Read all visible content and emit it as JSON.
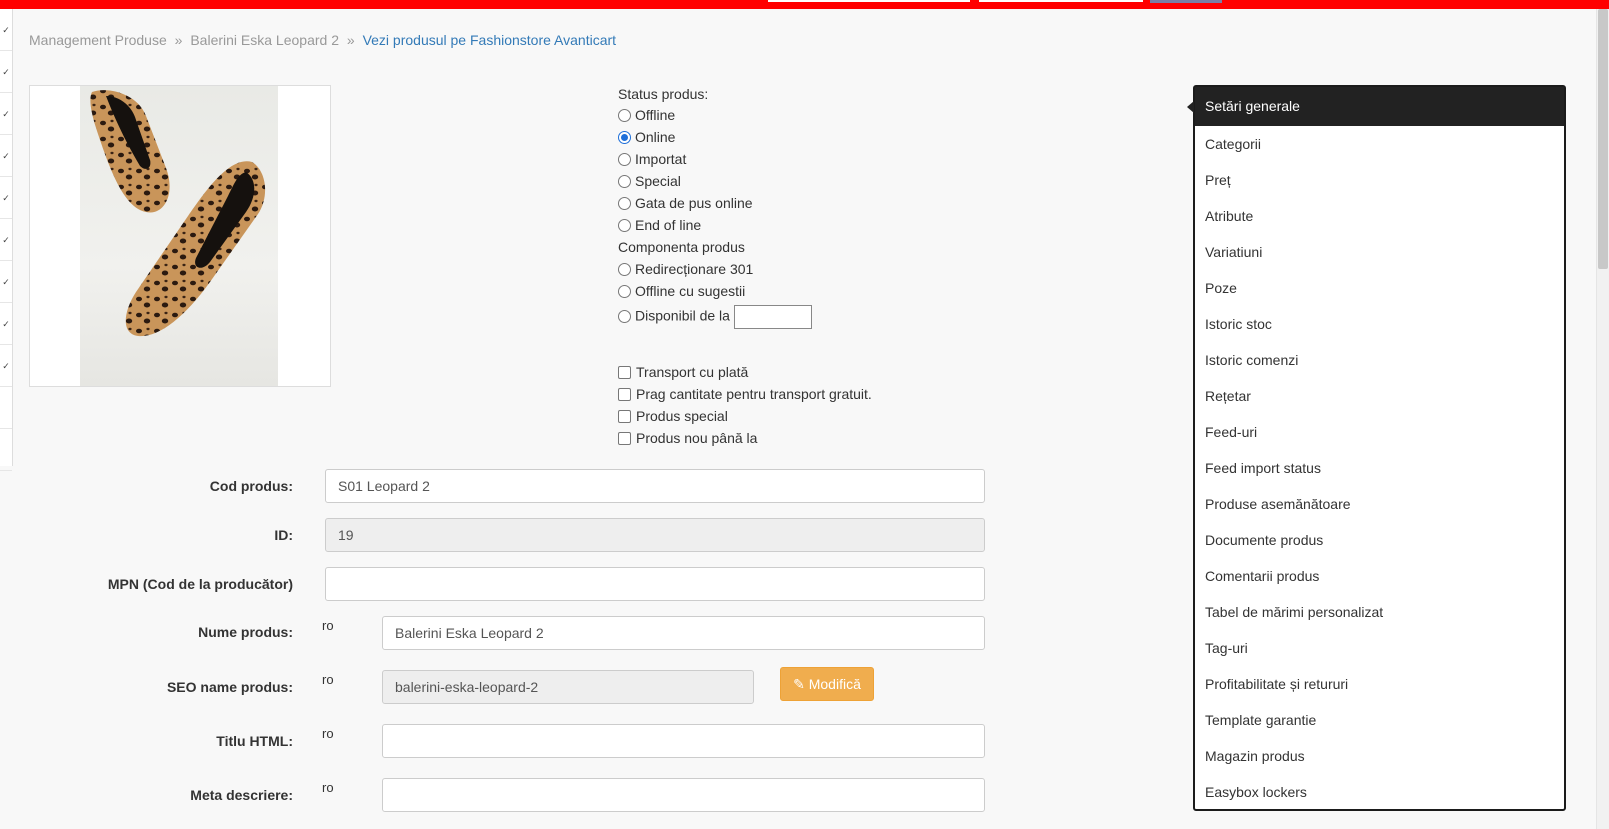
{
  "breadcrumb": {
    "item1": "Management Produse",
    "separator": "»",
    "item2": "Balerini Eska Leopard 2",
    "link": "Vezi produsul pe Fashionstore Avanticart"
  },
  "status": {
    "title": "Status produs:",
    "options": [
      "Offline",
      "Online",
      "Importat",
      "Special",
      "Gata de pus online",
      "End of line"
    ],
    "selected": "Online",
    "component_title": "Componenta produs",
    "component_options": [
      "Redirecționare 301",
      "Offline cu sugestii",
      "Disponibil de la"
    ],
    "checkboxes": [
      "Transport cu plată",
      "Prag cantitate pentru transport gratuit.",
      "Produs special",
      "Produs nou până la"
    ]
  },
  "form": {
    "cod_label": "Cod produs:",
    "cod_value": "S01 Leopard 2",
    "id_label": "ID:",
    "id_value": "19",
    "mpn_label": "MPN (Cod de la producător)",
    "mpn_value": "",
    "nume_label": "Nume produs:",
    "nume_value": "Balerini Eska Leopard 2",
    "seo_label": "SEO name produs:",
    "seo_value": "balerini-eska-leopard-2",
    "modifica_label": "Modifică",
    "titlu_label": "Titlu HTML:",
    "titlu_value": "",
    "meta_label": "Meta descriere:",
    "meta_value": "",
    "lang": "ro"
  },
  "menu": {
    "header": "Setări generale",
    "items": [
      "Categorii",
      "Preț",
      "Atribute",
      "Variatiuni",
      "Poze",
      "Istoric stoc",
      "Istoric comenzi",
      "Rețetar",
      "Feed-uri",
      "Feed import status",
      "Produse asemănătoare",
      "Documente produs",
      "Comentarii produs",
      "Tabel de mărimi personalizat",
      "Tag-uri",
      "Profitabilitate și retururi",
      "Template garantie",
      "Magazin produs",
      "Easybox lockers"
    ]
  },
  "colors": {
    "topbar": "#ff0000",
    "link": "#337ab7",
    "warning_button": "#f0ad4e",
    "menu_header": "#222222"
  },
  "icons": {
    "modifica": "pencil-icon",
    "left_strip": "check-icon"
  }
}
